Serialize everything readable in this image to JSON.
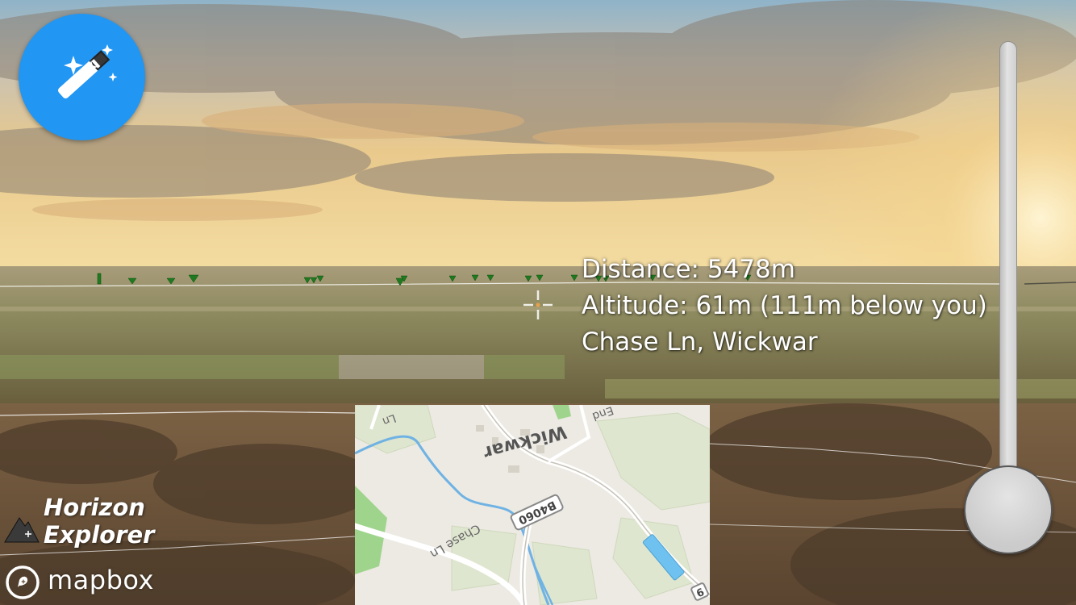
{
  "info": {
    "distance": "Distance: 5478m",
    "altitude": "Altitude: 61m (111m below you)",
    "location": "Chase Ln, Wickwar"
  },
  "branding": {
    "app_name_line1": "Horizon",
    "app_name_line2": "Explorer",
    "map_provider": "mapbox"
  },
  "minimap": {
    "labels": {
      "town": "Wickwar",
      "road_badge": "B4060",
      "road_chase": "Chase Ln",
      "road_top_left": "Ln",
      "road_top_right": "End",
      "road_edge": "9"
    }
  },
  "controls": {
    "magic_button_icon": "magic-wand-icon",
    "zoom_slider_value": 0.0
  },
  "colors": {
    "accent": "#2196f3",
    "marker_green": "#1f7a1f",
    "text": "#ffffff"
  }
}
